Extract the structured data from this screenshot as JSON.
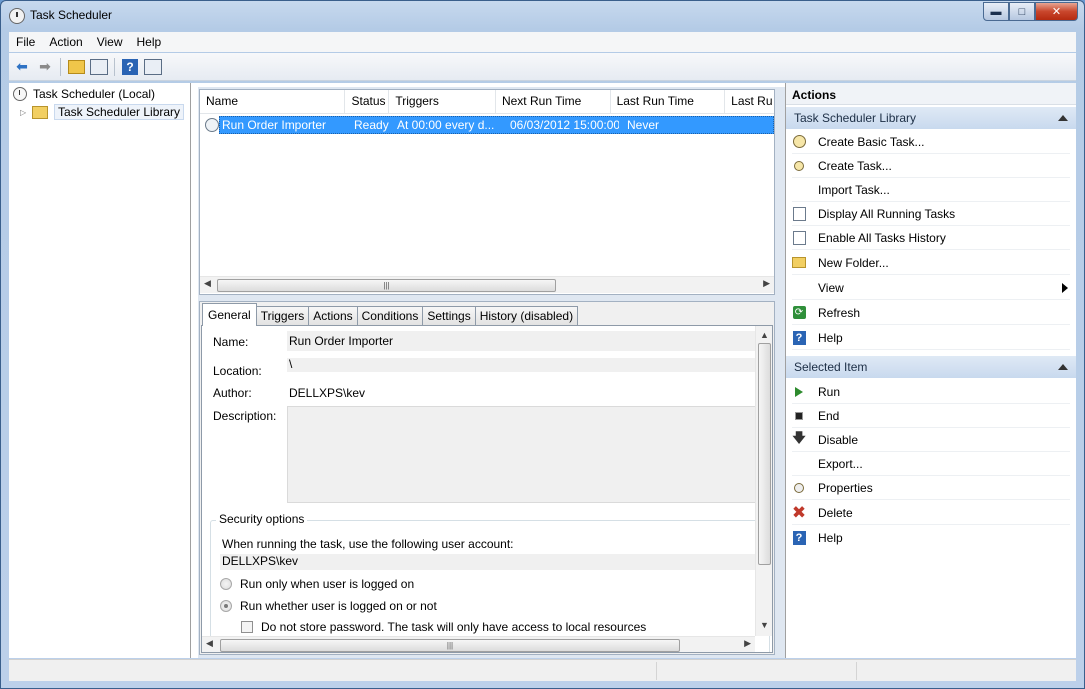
{
  "window": {
    "title": "Task Scheduler"
  },
  "menu": [
    "File",
    "Action",
    "View",
    "Help"
  ],
  "tree": {
    "root": "Task Scheduler (Local)",
    "library": "Task Scheduler Library"
  },
  "task_list": {
    "columns": [
      "Name",
      "Status",
      "Triggers",
      "Next Run Time",
      "Last Run Time",
      "Last Ru"
    ],
    "rows": [
      {
        "name": "Run Order Importer",
        "status": "Ready",
        "triggers": "At 00:00 every d...",
        "next_run": "06/03/2012 15:00:00",
        "last_run": "Never"
      }
    ]
  },
  "details": {
    "tabs": [
      "General",
      "Triggers",
      "Actions",
      "Conditions",
      "Settings",
      "History (disabled)"
    ],
    "name_label": "Name:",
    "name_value": "Run Order Importer",
    "location_label": "Location:",
    "location_value": "\\",
    "author_label": "Author:",
    "author_value": "DELLXPS\\kev",
    "description_label": "Description:",
    "security_title": "Security options",
    "security_prompt": "When running the task, use the following user account:",
    "account": "DELLXPS\\kev",
    "radio_logged_on": "Run only when user is logged on",
    "radio_whether": "Run whether user is logged on or not",
    "checkbox_no_store": "Do not store password.  The task will only have access to local resources"
  },
  "actions_pane": {
    "title": "Actions",
    "library_section": "Task Scheduler Library",
    "library_items": [
      {
        "label": "Create Basic Task...",
        "icon": "create-basic-task-icon"
      },
      {
        "label": "Create Task...",
        "icon": "create-task-icon"
      },
      {
        "label": "Import Task...",
        "icon": ""
      },
      {
        "label": "Display All Running Tasks",
        "icon": "running-tasks-icon"
      },
      {
        "label": "Enable All Tasks History",
        "icon": "tasks-history-icon"
      },
      {
        "label": "New Folder...",
        "icon": "new-folder-icon"
      },
      {
        "label": "View",
        "icon": ""
      },
      {
        "label": "Refresh",
        "icon": "refresh-icon"
      },
      {
        "label": "Help",
        "icon": "help-icon"
      }
    ],
    "selected_section": "Selected Item",
    "selected_items": [
      {
        "label": "Run",
        "icon": "run-icon"
      },
      {
        "label": "End",
        "icon": "end-icon"
      },
      {
        "label": "Disable",
        "icon": "disable-icon"
      },
      {
        "label": "Export...",
        "icon": ""
      },
      {
        "label": "Properties",
        "icon": "properties-icon"
      },
      {
        "label": "Delete",
        "icon": "delete-icon"
      },
      {
        "label": "Help",
        "icon": "help-icon"
      }
    ]
  },
  "colors": {
    "selection": "#3399ff",
    "section_header": "#c8d9ee"
  }
}
